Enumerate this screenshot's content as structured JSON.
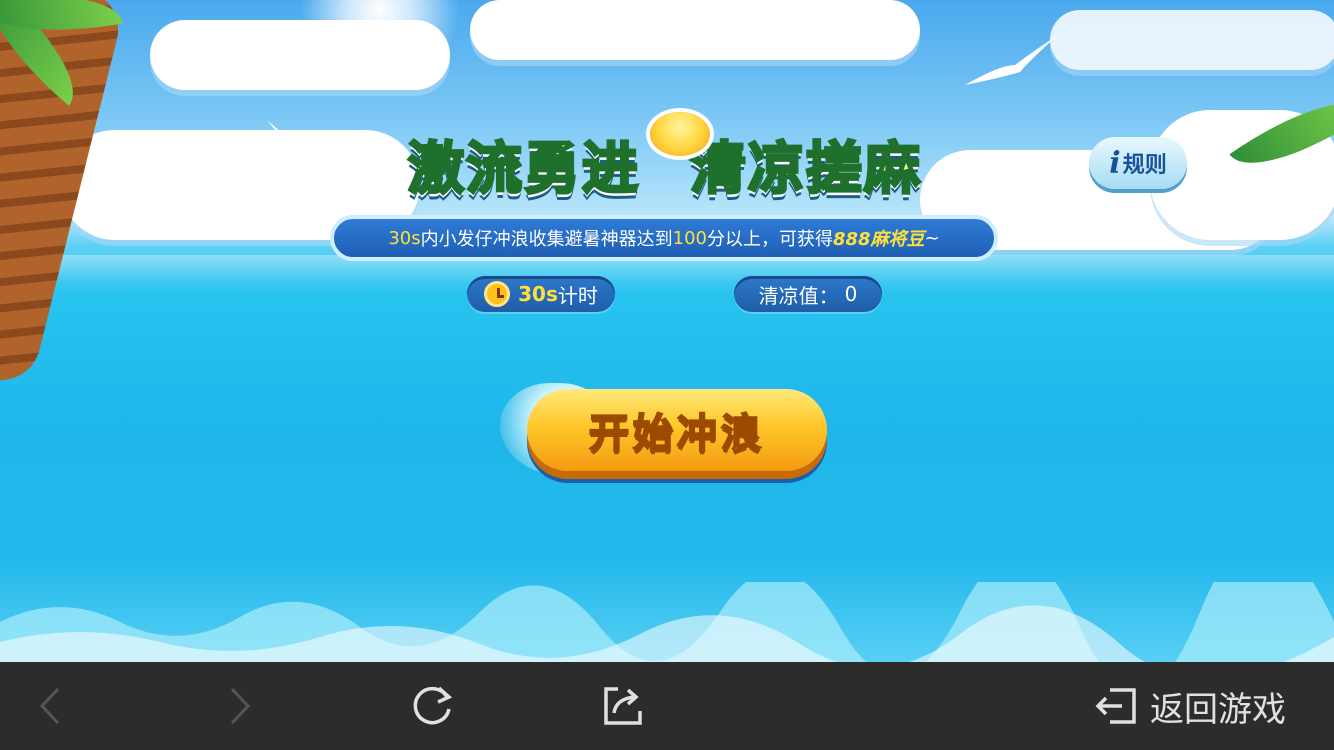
{
  "banner": {
    "title_part1": "激流勇进",
    "title_part2": "清凉搓麻",
    "subtitle_prefix": "30s",
    "subtitle_mid1": "内小发仔冲浪收集避暑神器达到",
    "subtitle_score": "100",
    "subtitle_mid2": "分以上，可获得",
    "subtitle_reward": "888麻将豆",
    "subtitle_suffix": "~"
  },
  "rules": {
    "icon": "info-i-icon",
    "label": "规则"
  },
  "timer": {
    "icon": "alarm-clock-icon",
    "value": "30s",
    "label": "计时"
  },
  "score": {
    "label": "清凉值：",
    "value": "0"
  },
  "start_button": {
    "label": "开始冲浪"
  },
  "bottom_bar": {
    "back_icon": "chevron-left-icon",
    "forward_icon": "chevron-right-icon",
    "refresh_icon": "refresh-icon",
    "share_icon": "share-icon",
    "exit_icon": "exit-icon",
    "return_label": "返回游戏"
  },
  "colors": {
    "bar_bg": "#2c2c2c",
    "accent_yellow": "#ffe03a",
    "pill_blue": "#1f5ea8",
    "start_orange": "#f49b12"
  }
}
